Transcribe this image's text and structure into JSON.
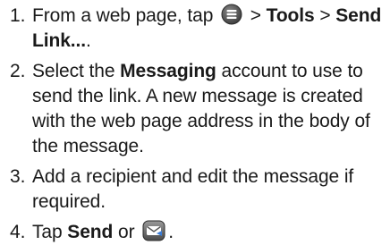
{
  "steps": [
    {
      "num": "1.",
      "before_icon": "From a web page, tap ",
      "icon": "menu-icon",
      "after_icon": " > ",
      "tools": "Tools",
      "sep": " > ",
      "send_link": "Send Link...",
      "end": "."
    },
    {
      "num": "2.",
      "before": "Select the ",
      "messaging": "Messaging",
      "after": " account to use to send the link. A new message is created with the web page address in the body of the message."
    },
    {
      "num": "3.",
      "text": "Add a recipient and edit the message if required."
    },
    {
      "num": "4.",
      "before": "Tap ",
      "send": "Send",
      "or": " or ",
      "icon": "send-icon",
      "end": "."
    }
  ]
}
